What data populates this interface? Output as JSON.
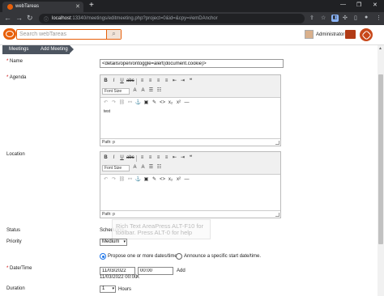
{
  "browser": {
    "tab_title": "webTareas",
    "tab_close": "✕",
    "new_tab": "+",
    "url_host": "localhost",
    "url_rest": ":13340/meetings/editmeeting.php?project=0&id=&cpy=#emDAnchor",
    "window_controls": [
      "—",
      "❐",
      "✕"
    ]
  },
  "header": {
    "search_placeholder": "Search webTareas",
    "user_name": "Administrator"
  },
  "breadcrumb": [
    "Meetings",
    "Add Meeting"
  ],
  "form": {
    "name_label": "Name",
    "name_value": "<details/open/ontoggle=alert(document.cookie)>",
    "agenda_label": "Agenda",
    "agenda_text": "test",
    "location_label": "Location",
    "font_size_label": "Font Size",
    "path_label": "Path: p",
    "status_label": "Status",
    "status_value": "Scheduling",
    "priority_label": "Priority",
    "priority_value": "Medium",
    "radio_option_1": "Propose one or more dates/times.",
    "radio_option_2": "Announce a specific start date/time.",
    "datetime_label": "Date/Time",
    "date_value": "11/03/2022",
    "time_value": "00:00",
    "add_label": "Add",
    "date_list_item": "11/03/2022 00:00",
    "remove_label": "X",
    "duration_label": "Duration",
    "duration_value": "1",
    "hours_label": "Hours"
  },
  "tooltip": {
    "line1": "Rich Text AreaPress ALT-F10 for",
    "line2": "toolbar. Press ALT-0 for help"
  },
  "colors": {
    "brand": "#e8600a",
    "breadcrumb_bg": "#4d5560",
    "chrome_bg": "#202124"
  }
}
